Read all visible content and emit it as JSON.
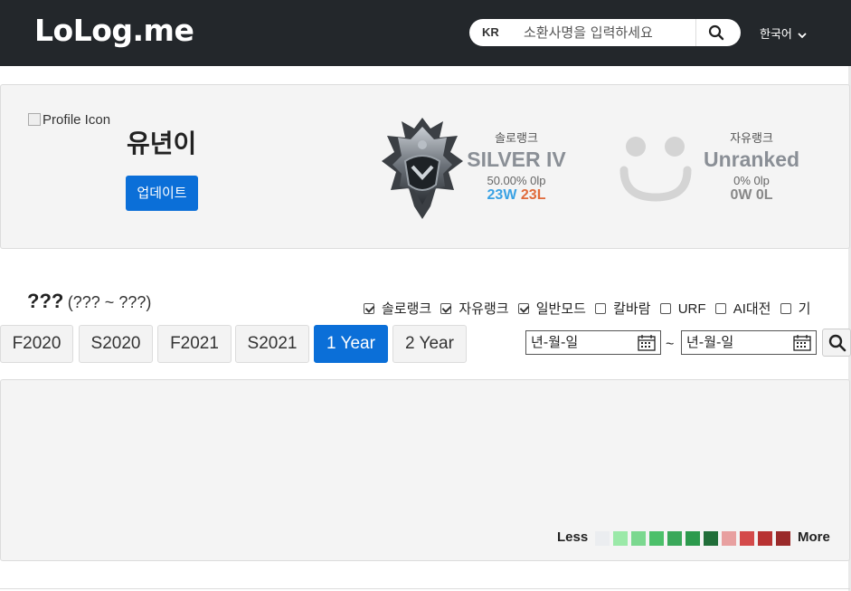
{
  "header": {
    "logo": "LoLog.me",
    "region": "KR",
    "search_placeholder": "소환사명을 입력하세요",
    "language": "한국어"
  },
  "profile": {
    "icon_alt": "Profile Icon",
    "name": "유년이",
    "update_label": "업데이트",
    "solo": {
      "label": "솔로랭크",
      "tier": "SILVER IV",
      "stats": "50.00% 0lp",
      "wins": "23W",
      "losses": "23L"
    },
    "flex": {
      "label": "자유랭크",
      "tier": "Unranked",
      "stats": "0% 0lp",
      "wins": "0W",
      "losses": "0L"
    }
  },
  "history": {
    "title": "???",
    "range": "(??? ~ ???)",
    "filters": [
      {
        "label": "솔로랭크",
        "checked": true
      },
      {
        "label": "자유랭크",
        "checked": true
      },
      {
        "label": "일반모드",
        "checked": true
      },
      {
        "label": "칼바람",
        "checked": false
      },
      {
        "label": "URF",
        "checked": false
      },
      {
        "label": "AI대전",
        "checked": false
      },
      {
        "label": "기",
        "checked": false
      }
    ],
    "seasons": [
      "F2020",
      "S2020",
      "F2021",
      "S2021",
      "1 Year",
      "2 Year"
    ],
    "active_season": "1 Year",
    "date_from": "년-월-일",
    "date_to": "년-월-일",
    "tilde": "~"
  },
  "heatmap_legend": {
    "less": "Less",
    "more": "More",
    "colors": [
      "#ebedf0",
      "#9be9a8",
      "#7bd88f",
      "#4cc06a",
      "#3aa85a",
      "#2c9a4d",
      "#216e39",
      "#e8a0a0",
      "#d44a4a",
      "#b83232",
      "#9a2a2a",
      "#7a1f1f"
    ]
  },
  "colors": {
    "header_bg": "#23272b",
    "accent": "#0b6fd8",
    "win": "#3aa2e4",
    "loss": "#e06a3a"
  }
}
